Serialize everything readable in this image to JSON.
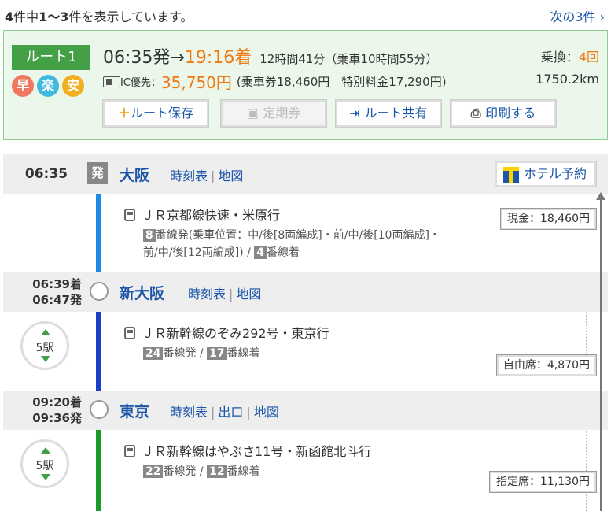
{
  "header": {
    "count_total": "4",
    "count_mid": "件中",
    "count_range": "1～3",
    "count_suffix": "件を表示しています。",
    "next_link": "次の3件 ›"
  },
  "summary": {
    "route_label": "ルート1",
    "marks": [
      {
        "label": "早",
        "color": "#f07860"
      },
      {
        "label": "楽",
        "color": "#40b8e0"
      },
      {
        "label": "安",
        "color": "#f0b020"
      }
    ],
    "depart_time": "06:35発",
    "arrow": "→",
    "arrive_time": "19:16着",
    "duration": "12時間41分（乗車10時間55分）",
    "ic_label": "IC優先：",
    "fare": "35,750円",
    "fare_detail": "(乗車券18,460円　特別料金17,290円)",
    "transfers_label": "乗換：",
    "transfers_value": "4回",
    "distance": "1750.2km",
    "buttons": {
      "save": "ルート保存",
      "commuter": "定期券",
      "share": "ルート共有",
      "print": "印刷する"
    }
  },
  "detail": {
    "hotel_button": "ホテル予約",
    "stations": [
      {
        "time1": "06:35",
        "time2": "",
        "badge": "発",
        "name": "大阪",
        "links": [
          "時刻表",
          "地図"
        ]
      },
      {
        "time1": "06:39着",
        "time2": "06:47発",
        "name": "新大阪",
        "links": [
          "時刻表",
          "地図"
        ]
      },
      {
        "time1": "09:20着",
        "time2": "09:36発",
        "name": "東京",
        "links": [
          "時刻表",
          "出口",
          "地図"
        ]
      }
    ],
    "segments": [
      {
        "train": "ＪＲ京都線快速・米原行",
        "dep_platform": "8",
        "dep_text": "番線発(乗車位置：中/後[8両編成]・前/中/後[10両編成]・",
        "dep_text2": "前/中/後[12両編成])",
        "arr_platform": "4",
        "arr_text": "番線着",
        "price": "現金：18,460円",
        "line_color": "#1e88e5",
        "stops": ""
      },
      {
        "train": "ＪＲ新幹線のぞみ292号・東京行",
        "dep_platform": "24",
        "dep_text": "番線発",
        "arr_platform": "17",
        "arr_text": "番線着",
        "price": "自由席：4,870円",
        "line_color": "#1a3fc8",
        "stops": "5駅"
      },
      {
        "train": "ＪＲ新幹線はやぶさ11号・新函館北斗行",
        "dep_platform": "22",
        "dep_text": "番線発",
        "arr_platform": "12",
        "arr_text": "番線着",
        "price": "指定席：11,130円",
        "line_color": "#1a9a2a",
        "stops": "5駅"
      }
    ]
  }
}
